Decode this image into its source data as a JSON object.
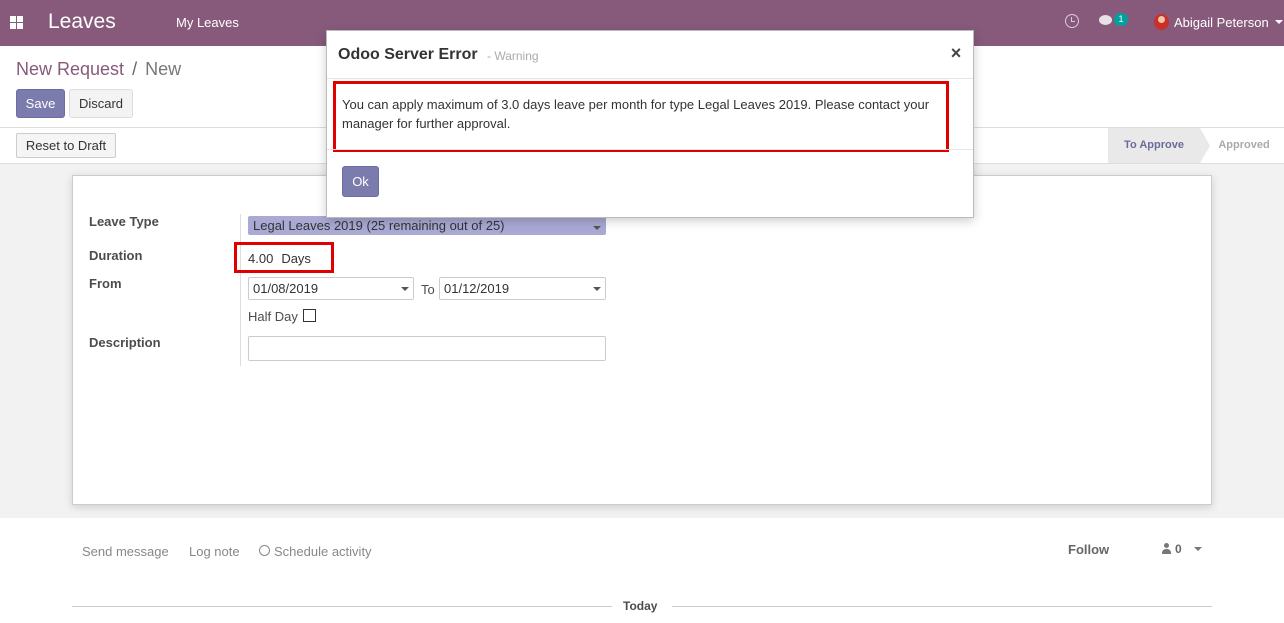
{
  "navbar": {
    "app_title": "Leaves",
    "menu_item": "My Leaves",
    "chat_badge": "1",
    "user_name": "Abigail Peterson"
  },
  "breadcrumb": {
    "parent": "New Request",
    "separator": "/",
    "current": "New"
  },
  "buttons": {
    "save": "Save",
    "discard": "Discard",
    "reset_to_draft": "Reset to Draft",
    "ok": "Ok"
  },
  "statusbar": {
    "stages": [
      "To Approve",
      "Approved"
    ],
    "active_stage": "To Approve"
  },
  "form": {
    "leave_type_label": "Leave Type",
    "leave_type_value": "Legal Leaves 2019 (25 remaining out of 25)",
    "duration_label": "Duration",
    "duration_value": "4.00",
    "duration_unit": "Days",
    "from_label": "From",
    "from_value": "01/08/2019",
    "to_label": "To",
    "to_value": "01/12/2019",
    "half_day_label": "Half Day",
    "half_day_checked": false,
    "description_label": "Description",
    "description_value": ""
  },
  "chatter": {
    "send_message": "Send message",
    "log_note": "Log note",
    "schedule_activity": "Schedule activity",
    "follow": "Follow",
    "followers_count": "0",
    "today": "Today"
  },
  "modal": {
    "title": "Odoo Server Error",
    "subtitle": "- Warning",
    "close": "×",
    "message": "You can apply maximum of 3.0 days leave per month for type Legal Leaves 2019. Please contact your manager for further approval."
  },
  "colors": {
    "navbar": "#875a7b",
    "primary_button": "#7c7bad",
    "highlight": "#e00000"
  }
}
